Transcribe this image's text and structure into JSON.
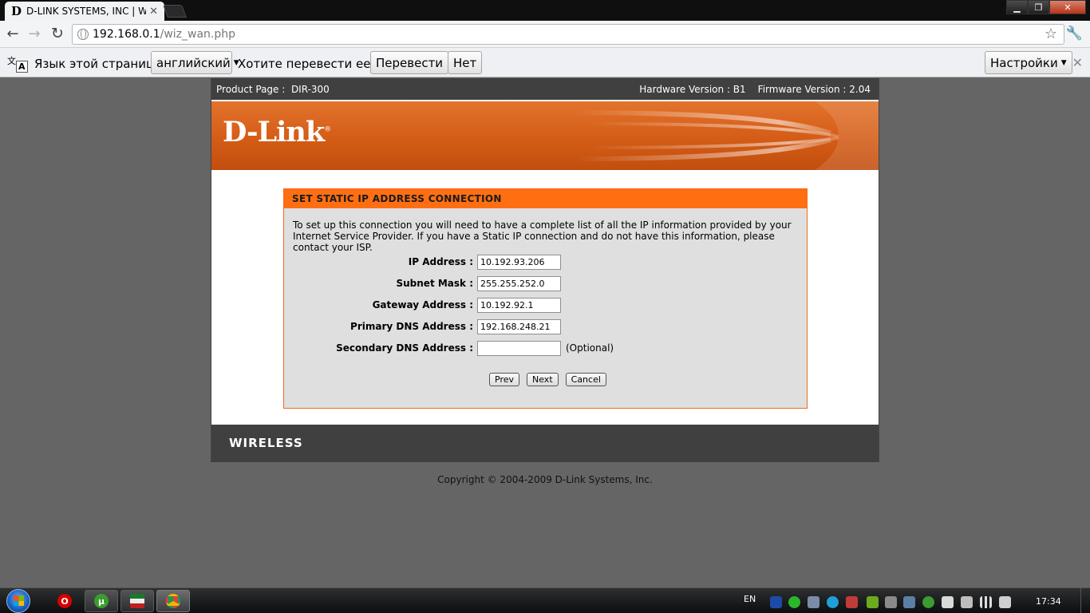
{
  "browser": {
    "tab_title": "D-LINK SYSTEMS, INC | WIR",
    "tab_favicon": "D",
    "url_host": "192.168.0.1",
    "url_path": "/wiz_wan.php"
  },
  "translate_bar": {
    "page_language_label": "Язык этой страницы",
    "language_value": "английский",
    "question": "Хотите перевести ее?",
    "translate_button": "Перевести",
    "no_button": "Нет",
    "settings_button": "Настройки"
  },
  "router": {
    "product_page_label": "Product Page :",
    "product_model": "DIR-300",
    "hardware_version": "Hardware Version : B1",
    "firmware_version": "Firmware Version : 2.04",
    "logo": "D-Link",
    "footer_brand": "WIRELESS",
    "copyright": "Copyright © 2004-2009 D-Link Systems, Inc."
  },
  "wizard": {
    "title": "SET STATIC IP ADDRESS CONNECTION",
    "intro": "To set up this connection you will need to have a complete list of all the IP information provided by your Internet Service Provider. If you have a Static IP connection and do not have this information, please contact your ISP.",
    "fields": [
      {
        "label": "IP Address :",
        "value": "10.192.93.206",
        "note": ""
      },
      {
        "label": "Subnet Mask :",
        "value": "255.255.252.0",
        "note": ""
      },
      {
        "label": "Gateway Address :",
        "value": "10.192.92.1",
        "note": ""
      },
      {
        "label": "Primary DNS Address :",
        "value": "192.168.248.21",
        "note": ""
      },
      {
        "label": "Secondary DNS Address :",
        "value": "",
        "note": "(Optional)"
      }
    ],
    "buttons": {
      "prev": "Prev",
      "next": "Next",
      "cancel": "Cancel"
    }
  },
  "taskbar": {
    "language": "EN",
    "clock": "17:34",
    "apps": [
      "opera-icon",
      "utorrent-icon",
      "flag-app-icon",
      "chrome-icon"
    ],
    "accent_orange": "#ff6f12",
    "accent_blue": "#1f64c4"
  }
}
